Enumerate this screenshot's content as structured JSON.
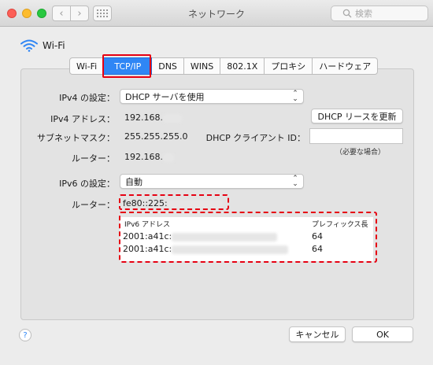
{
  "window": {
    "title": "ネットワーク",
    "search_placeholder": "検索"
  },
  "interface": {
    "name": "Wi-Fi"
  },
  "tabs": [
    {
      "label": "Wi-Fi"
    },
    {
      "label": "TCP/IP"
    },
    {
      "label": "DNS"
    },
    {
      "label": "WINS"
    },
    {
      "label": "802.1X"
    },
    {
      "label": "プロキシ"
    },
    {
      "label": "ハードウェア"
    }
  ],
  "active_tab": "TCP/IP",
  "ipv4": {
    "config_label": "IPv4 の設定：",
    "config_value": "DHCP サーバを使用",
    "address_label": "IPv4 アドレス：",
    "address_value": "192.168.",
    "subnet_label": "サブネットマスク：",
    "subnet_value": "255.255.255.0",
    "router_label": "ルーター：",
    "router_value": "192.168.",
    "renew_button": "DHCP リースを更新",
    "client_id_label": "DHCP クライアント ID：",
    "client_id_value": "",
    "client_id_hint": "（必要な場合）"
  },
  "ipv6": {
    "config_label": "IPv6 の設定：",
    "config_value": "自動",
    "router_label": "ルーター：",
    "router_value": "fe80::225:",
    "table": {
      "columns": [
        "IPv6 アドレス",
        "プレフィックス長"
      ],
      "rows": [
        {
          "address": "2001:a41c:",
          "prefix": "64"
        },
        {
          "address": "2001:a41c:",
          "prefix": "64"
        }
      ]
    }
  },
  "footer": {
    "help": "?",
    "cancel": "キャンセル",
    "ok": "OK"
  },
  "colors": {
    "accent": "#2f86f5",
    "highlight": "#e60012"
  }
}
